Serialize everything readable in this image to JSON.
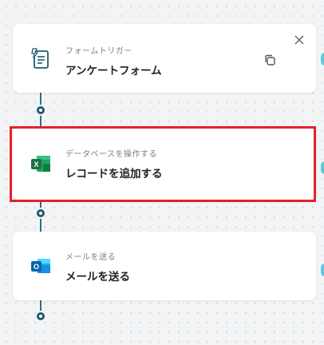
{
  "steps": [
    {
      "subtitle": "フォームトリガー",
      "title": "アンケートフォーム",
      "icon": "form-document-icon"
    },
    {
      "subtitle": "データベースを操作する",
      "title": "レコードを追加する",
      "icon": "excel-icon",
      "icon_letter": "X"
    },
    {
      "subtitle": "メールを送る",
      "title": "メールを送る",
      "icon": "outlook-icon",
      "icon_letter": "O"
    }
  ],
  "colors": {
    "connector": "#2f6f86",
    "highlight": "#e5212a",
    "excel_green": "#1e7145",
    "outlook_blue": "#0a64ad",
    "form_icon": "#1f5b73"
  }
}
